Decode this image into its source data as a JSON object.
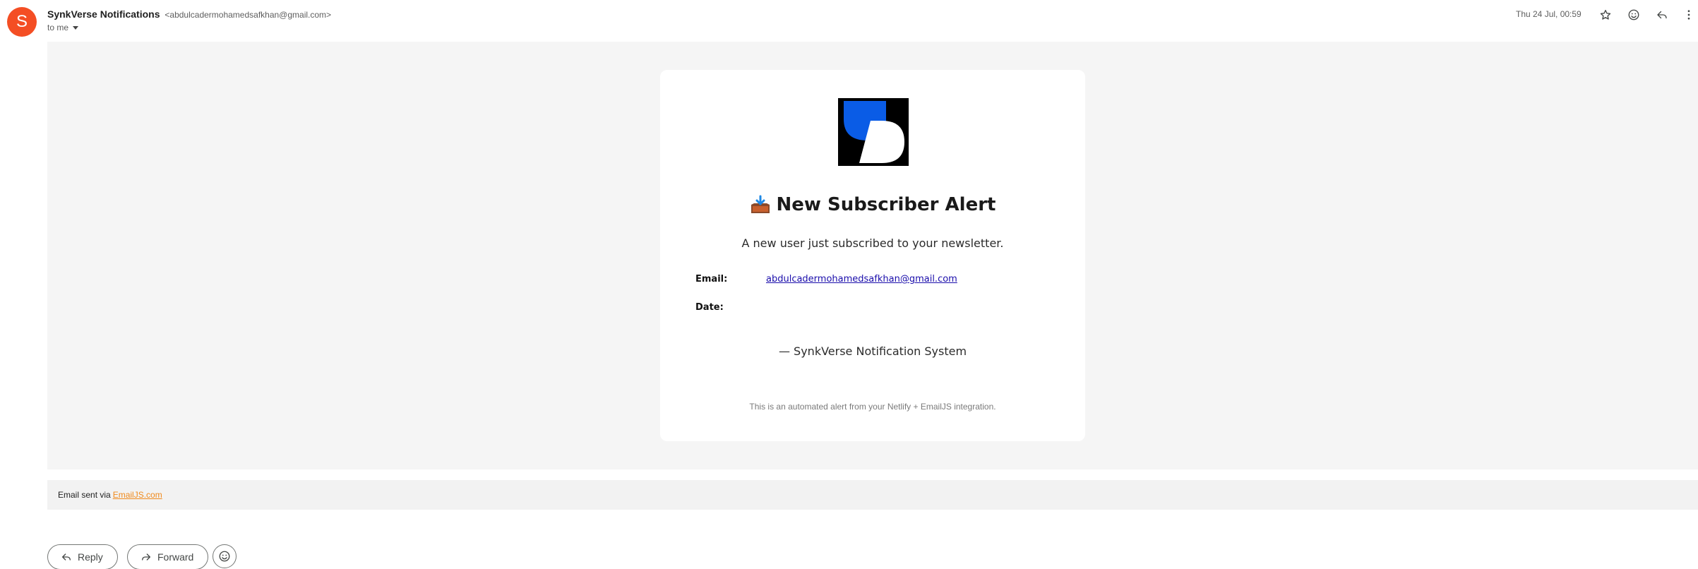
{
  "header": {
    "avatar_letter": "S",
    "sender_name": "SynkVerse Notifications",
    "sender_email": "<abdulcadermohamedsafkhan@gmail.com>",
    "recipient": "to me",
    "date": "Thu 24 Jul, 00:59",
    "icons": [
      "star-icon",
      "emoji-reaction-icon",
      "reply-icon",
      "more-options-icon"
    ]
  },
  "email": {
    "title": "New Subscriber Alert",
    "subtitle": "A new user just subscribed to your newsletter.",
    "fields": {
      "email_label": "Email:",
      "email_value": "abdulcadermohamedsafkhan@gmail.com",
      "date_label": "Date:",
      "date_value": ""
    },
    "signature": "— SynkVerse Notification System",
    "footer_note": "This is an automated alert from your Netlify + EmailJS integration."
  },
  "sent_via": {
    "prefix": "Email sent via",
    "link": "EmailJS.com"
  },
  "actions": {
    "reply": "Reply",
    "forward": "Forward"
  },
  "colors": {
    "avatar": "#f44e24",
    "logo_blue": "#0a5ce6",
    "link": "#1a0dab",
    "sent_via_link": "#f08a1c"
  }
}
